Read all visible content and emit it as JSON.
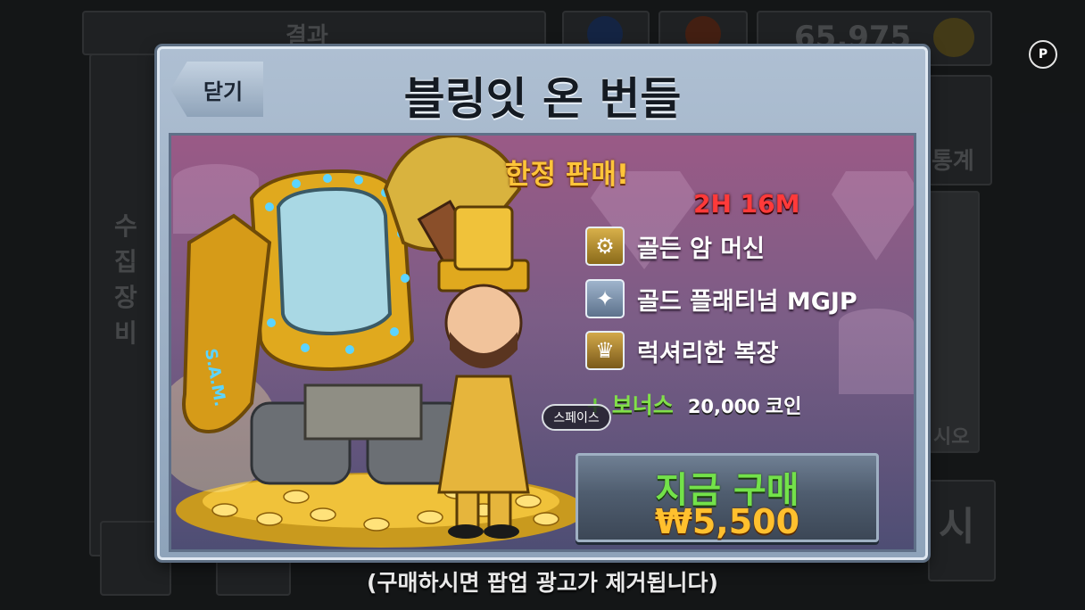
{
  "background": {
    "results_tab": "결과",
    "coins": "65,975",
    "left_menu": [
      "수집",
      "장비"
    ],
    "right_labels": [
      "통계",
      "시오",
      "시"
    ]
  },
  "popup": {
    "close_label": "닫기",
    "title": "블링잇 온 번들",
    "limited_label": "한정 판매!",
    "timer": "2H 16M",
    "items": [
      {
        "label": "골든 암 머신",
        "icon": "golden-arm-machine-icon"
      },
      {
        "label": "골드 플래티넘 MGJP",
        "icon": "gold-platinum-mgjp-icon"
      },
      {
        "label": "럭셔리한 복장",
        "icon": "luxury-outfit-icon"
      }
    ],
    "bonus": {
      "label": "보너스",
      "amount": "20,000",
      "unit": "코인"
    },
    "buy": {
      "label": "지금 구매",
      "price": "₩5,500"
    },
    "space_hint": "스페이스",
    "robot_text": "S.A.M."
  },
  "footnote": "(구매하시면 팝업 광고가 제거됩니다)",
  "p_button": "P"
}
